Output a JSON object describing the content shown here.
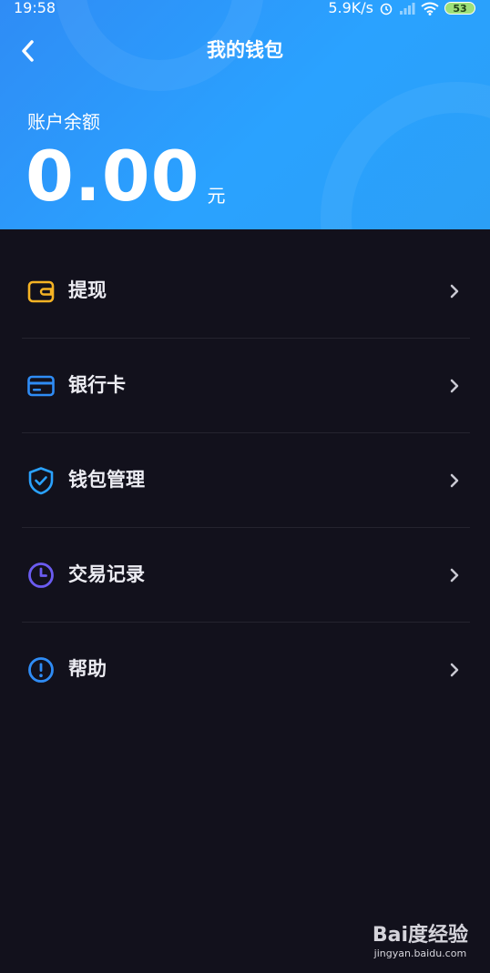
{
  "status_bar": {
    "time": "19:58",
    "net_speed": "5.9K/s",
    "battery": "53"
  },
  "header": {
    "title": "我的钱包",
    "balance_label": "账户余额",
    "balance_amount": "0.00",
    "balance_unit": "元"
  },
  "menu": {
    "items": [
      {
        "label": "提现",
        "icon": "wallet-icon",
        "color": "#f5b324"
      },
      {
        "label": "银行卡",
        "icon": "bank-card-icon",
        "color": "#2f8cf5"
      },
      {
        "label": "钱包管理",
        "icon": "shield-check-icon",
        "color": "#2aa2ff"
      },
      {
        "label": "交易记录",
        "icon": "clock-icon",
        "color": "#6b5cf0"
      },
      {
        "label": "帮助",
        "icon": "info-icon",
        "color": "#2f8cf5"
      }
    ]
  },
  "watermark": {
    "logo": "Bai度经验",
    "url": "jingyan.baidu.com"
  },
  "colors": {
    "header_blue": "#2aa2ff",
    "background": "#12111c"
  }
}
